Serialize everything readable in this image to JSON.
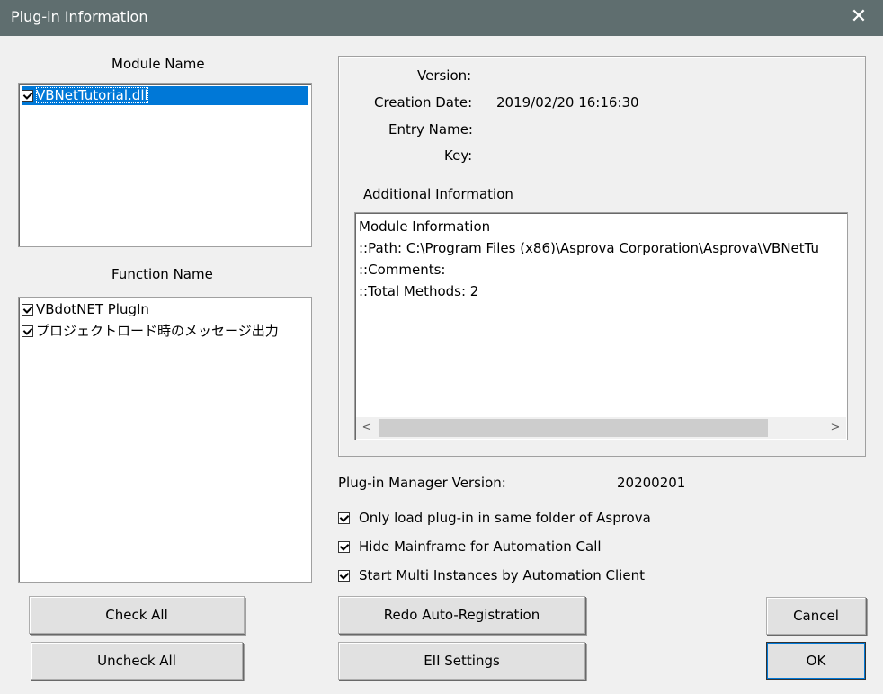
{
  "window": {
    "title": "Plug-in Information",
    "close_glyph": "✕"
  },
  "module_list": {
    "header": "Module Name",
    "items": [
      {
        "label": "VBNetTutorial.dll",
        "checked": true,
        "selected": true
      }
    ]
  },
  "function_list": {
    "header": "Function Name",
    "items": [
      {
        "label": "VBdotNET PlugIn",
        "checked": true
      },
      {
        "label": "プロジェクトロード時のメッセージ出力",
        "checked": true
      }
    ]
  },
  "details": {
    "version_label": "Version:",
    "version_value": "",
    "creation_date_label": "Creation Date:",
    "creation_date_value": "2019/02/20  16:16:30",
    "entry_name_label": "Entry Name:",
    "entry_name_value": "",
    "key_label": "Key:",
    "key_value": "",
    "additional_info_label": "Additional Information",
    "additional_info_lines": [
      "Module Information",
      "::Path: C:\\Program Files (x86)\\Asprova Corporation\\Asprova\\VBNetTu",
      "::Comments:",
      "::Total Methods: 2"
    ]
  },
  "manager": {
    "version_label": "Plug-in Manager Version:",
    "version_value": "20200201"
  },
  "options": {
    "only_load_same_folder": {
      "label": "Only load plug-in in same folder of Asprova",
      "checked": true
    },
    "hide_mainframe": {
      "label": "Hide Mainframe for Automation Call",
      "checked": true
    },
    "start_multi_instances": {
      "label": "Start Multi Instances by Automation Client",
      "checked": true
    }
  },
  "buttons": {
    "check_all": "Check All",
    "uncheck_all": "Uncheck All",
    "redo_auto_registration": "Redo Auto-Registration",
    "eii_settings": "EII Settings",
    "cancel": "Cancel",
    "ok": "OK"
  },
  "colors": {
    "titlebar": "#5f6e6f",
    "selection": "#0078d7",
    "background": "#f0f0f0"
  }
}
